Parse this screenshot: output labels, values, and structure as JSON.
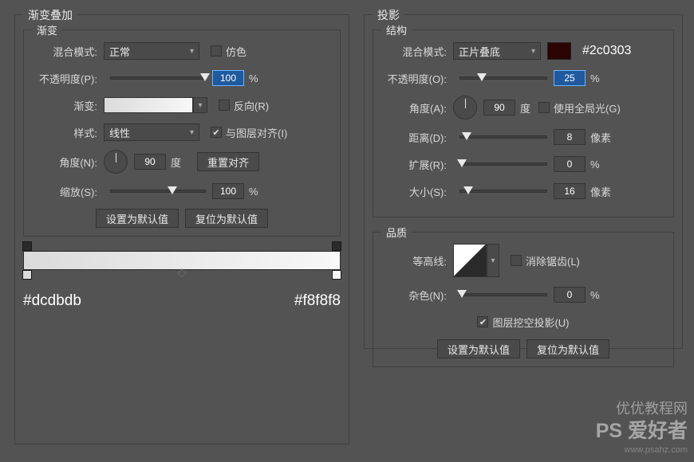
{
  "left": {
    "title": "渐变叠加",
    "group_title": "渐变",
    "blend_label": "混合模式:",
    "blend_value": "正常",
    "dither_label": "仿色",
    "opacity_label": "不透明度(P):",
    "opacity_value": "100",
    "opacity_unit": "%",
    "gradient_label": "渐变:",
    "reverse_label": "反向(R)",
    "style_label": "样式:",
    "style_value": "线性",
    "align_label": "与图层对齐(I)",
    "angle_label": "角度(N):",
    "angle_value": "90",
    "angle_unit": "度",
    "reset_align_btn": "重置对齐",
    "scale_label": "缩放(S):",
    "scale_value": "100",
    "scale_unit": "%",
    "btn_default": "设置为默认值",
    "btn_reset": "复位为默认值",
    "color1": "#dcdbdb",
    "color2": "#f8f8f8"
  },
  "right": {
    "title": "投影",
    "group1_title": "结构",
    "blend_label": "混合模式:",
    "blend_value": "正片叠底",
    "blend_color": "#2c0303",
    "opacity_label": "不透明度(O):",
    "opacity_value": "25",
    "opacity_unit": "%",
    "angle_label": "角度(A):",
    "angle_value": "90",
    "angle_unit": "度",
    "global_label": "使用全局光(G)",
    "distance_label": "距离(D):",
    "distance_value": "8",
    "distance_unit": "像素",
    "spread_label": "扩展(R):",
    "spread_value": "0",
    "spread_unit": "%",
    "size_label": "大小(S):",
    "size_value": "16",
    "size_unit": "像素",
    "group2_title": "品质",
    "contour_label": "等高线:",
    "antialias_label": "消除锯齿(L)",
    "noise_label": "杂色(N):",
    "noise_value": "0",
    "noise_unit": "%",
    "knockout_label": "图层挖空投影(U)",
    "btn_default": "设置为默认值",
    "btn_reset": "复位为默认值"
  },
  "watermark": {
    "line1": "优优教程网",
    "line2": "PS 爱好者",
    "line3": "www.psahz.com"
  }
}
